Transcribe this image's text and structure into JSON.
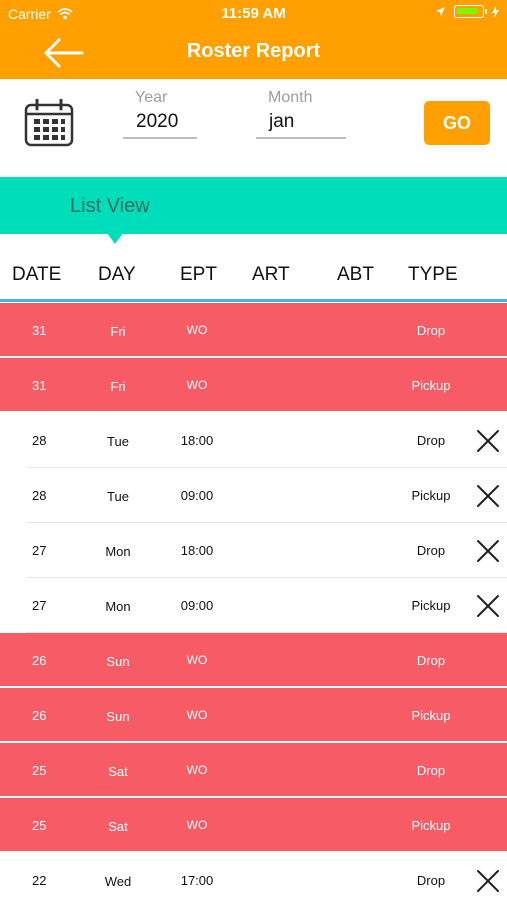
{
  "status": {
    "carrier": "Carrier",
    "time": "11:59 AM"
  },
  "nav": {
    "title": "Roster Report",
    "back_icon": "arrow-left-icon"
  },
  "filter": {
    "year_label": "Year",
    "year_value": "2020",
    "month_label": "Month",
    "month_value": "jan",
    "go_label": "GO"
  },
  "list_view_label": "List View",
  "table": {
    "headers": [
      "DATE",
      "DAY",
      "EPT",
      "ART",
      "ABT",
      "TYPE"
    ],
    "rows": [
      {
        "date": "31",
        "day": "Fri",
        "ept": "WO",
        "type": "Drop",
        "off": true
      },
      {
        "date": "31",
        "day": "Fri",
        "ept": "WO",
        "type": "Pickup",
        "off": true
      },
      {
        "date": "28",
        "day": "Tue",
        "ept": "18:00",
        "type": "Drop",
        "off": false
      },
      {
        "date": "28",
        "day": "Tue",
        "ept": "09:00",
        "type": "Pickup",
        "off": false
      },
      {
        "date": "27",
        "day": "Mon",
        "ept": "18:00",
        "type": "Drop",
        "off": false
      },
      {
        "date": "27",
        "day": "Mon",
        "ept": "09:00",
        "type": "Pickup",
        "off": false
      },
      {
        "date": "26",
        "day": "Sun",
        "ept": "WO",
        "type": "Drop",
        "off": true
      },
      {
        "date": "26",
        "day": "Sun",
        "ept": "WO",
        "type": "Pickup",
        "off": true
      },
      {
        "date": "25",
        "day": "Sat",
        "ept": "WO",
        "type": "Drop",
        "off": true
      },
      {
        "date": "25",
        "day": "Sat",
        "ept": "WO",
        "type": "Pickup",
        "off": true
      },
      {
        "date": "22",
        "day": "Wed",
        "ept": "17:00",
        "type": "Drop",
        "off": false
      }
    ]
  },
  "colors": {
    "accent": "#FFA000",
    "teal": "#00DDBA",
    "off_row": "#F75B66",
    "divider": "#3EB5E6"
  }
}
